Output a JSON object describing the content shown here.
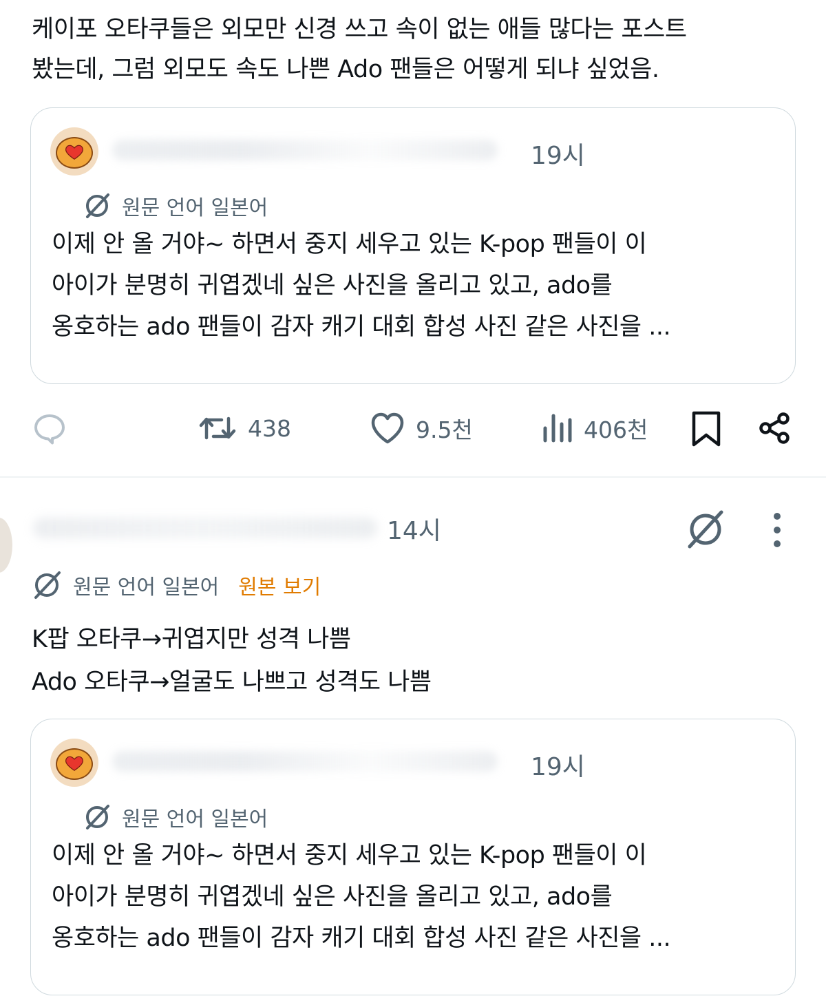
{
  "post1": {
    "text": "케이포 오타쿠들은 외모만 신경 쓰고 속이 없는 애들 많다는 포스트\n봤는데, 그럼 외모도 속도 나쁜 Ado 팬들은 어떻게 되냐 싶었음.",
    "quote": {
      "time": "19시",
      "translation_label": "원문 언어 일본어",
      "body": "이제 안 올 거야~ 하면서 중지 세우고 있는 K-pop 팬들이 이\n아이가 분명히 귀엽겠네 싶은 사진을 올리고 있고, ado를\n옹호하는 ado 팬들이 감자 캐기 대회 합성 사진 같은 사진을 ..."
    },
    "actions": {
      "retweets": "438",
      "likes": "9.5천",
      "views": "406천"
    }
  },
  "post2": {
    "time": "14시",
    "translation_label": "원문 언어 일본어",
    "view_original_label": "원본 보기",
    "text": "K팝 오타쿠→귀엽지만 성격 나쁨\nAdo 오타쿠→얼굴도 나쁘고 성격도 나쁨",
    "quote": {
      "time": "19시",
      "translation_label": "원문 언어 일본어",
      "body": "이제 안 올 거야~ 하면서 중지 세우고 있는 K-pop 팬들이 이\n아이가 분명히 귀엽겠네 싶은 사진을 올리고 있고, ado를\n옹호하는 ado 팬들이 감자 캐기 대회 합성 사진 같은 사진을 ..."
    }
  },
  "icons": {
    "reply": "reply-icon",
    "retweet": "retweet-icon",
    "like": "heart-icon",
    "views": "views-icon",
    "bookmark": "bookmark-icon",
    "share": "share-icon",
    "translate": "translate-icon",
    "more": "more-icon"
  },
  "colors": {
    "text": "#0f1419",
    "secondary": "#536471",
    "border": "#cfd9de",
    "view_original": "#e07b00"
  }
}
